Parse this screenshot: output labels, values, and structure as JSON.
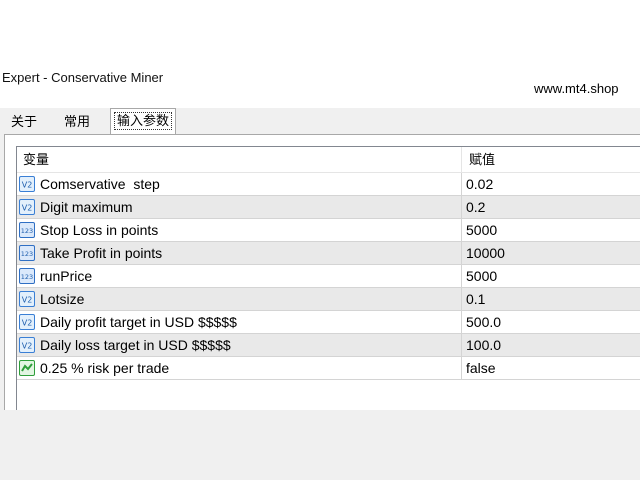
{
  "window": {
    "title": "Expert - Conservative Miner",
    "watermark": "www.mt4.shop"
  },
  "tabs": [
    {
      "label": "关于",
      "active": false
    },
    {
      "label": "常用",
      "active": false
    },
    {
      "label": "输入参数",
      "active": true
    }
  ],
  "table": {
    "columns": {
      "variable": "变量",
      "value": "赋值"
    },
    "rows": [
      {
        "icon": "double-value-icon",
        "name": "Comservative  step",
        "value": "0.02"
      },
      {
        "icon": "double-value-icon",
        "name": "Digit maximum",
        "value": "0.2"
      },
      {
        "icon": "integer-value-icon",
        "name": "Stop Loss in points",
        "value": "5000"
      },
      {
        "icon": "integer-value-icon",
        "name": "Take Profit in points",
        "value": "10000"
      },
      {
        "icon": "integer-value-icon",
        "name": "runPrice",
        "value": "5000"
      },
      {
        "icon": "double-value-icon",
        "name": "Lotsize",
        "value": "0.1"
      },
      {
        "icon": "double-value-icon",
        "name": "Daily profit target in USD $$$$$",
        "value": "500.0"
      },
      {
        "icon": "double-value-icon",
        "name": "Daily loss target in USD $$$$$",
        "value": "100.0"
      },
      {
        "icon": "boolean-value-icon",
        "name": "0.25 % risk per trade",
        "value": "false"
      }
    ]
  },
  "colors": {
    "row_alt": "#e9e9e9",
    "tab_bar": "#f0f0f0",
    "icon_blue": "#3a7fd5",
    "icon_green": "#2e9e3a"
  }
}
